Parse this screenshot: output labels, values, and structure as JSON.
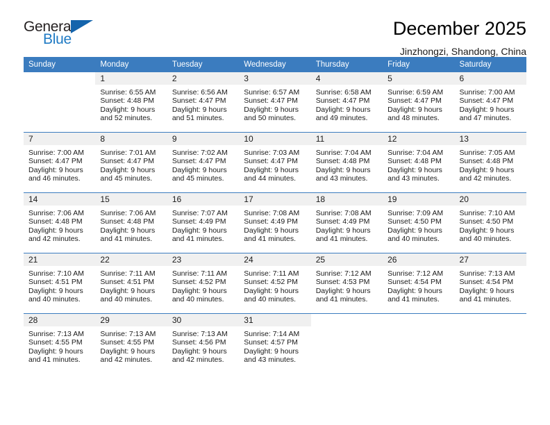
{
  "brand": {
    "name_top": "General",
    "name_bottom": "Blue",
    "triangle_color": "#1464ac",
    "blue_color": "#1f7ac4"
  },
  "header": {
    "title": "December 2025",
    "subtitle": "Jinzhongzi, Shandong, China",
    "header_bg": "#3b7cbf",
    "daynum_bg": "#f0f0f0"
  },
  "weekdays": [
    "Sunday",
    "Monday",
    "Tuesday",
    "Wednesday",
    "Thursday",
    "Friday",
    "Saturday"
  ],
  "weeks": [
    [
      {
        "day": "",
        "sunrise": "",
        "sunset": "",
        "daylight1": "",
        "daylight2": ""
      },
      {
        "day": "1",
        "sunrise": "Sunrise: 6:55 AM",
        "sunset": "Sunset: 4:48 PM",
        "daylight1": "Daylight: 9 hours",
        "daylight2": "and 52 minutes."
      },
      {
        "day": "2",
        "sunrise": "Sunrise: 6:56 AM",
        "sunset": "Sunset: 4:47 PM",
        "daylight1": "Daylight: 9 hours",
        "daylight2": "and 51 minutes."
      },
      {
        "day": "3",
        "sunrise": "Sunrise: 6:57 AM",
        "sunset": "Sunset: 4:47 PM",
        "daylight1": "Daylight: 9 hours",
        "daylight2": "and 50 minutes."
      },
      {
        "day": "4",
        "sunrise": "Sunrise: 6:58 AM",
        "sunset": "Sunset: 4:47 PM",
        "daylight1": "Daylight: 9 hours",
        "daylight2": "and 49 minutes."
      },
      {
        "day": "5",
        "sunrise": "Sunrise: 6:59 AM",
        "sunset": "Sunset: 4:47 PM",
        "daylight1": "Daylight: 9 hours",
        "daylight2": "and 48 minutes."
      },
      {
        "day": "6",
        "sunrise": "Sunrise: 7:00 AM",
        "sunset": "Sunset: 4:47 PM",
        "daylight1": "Daylight: 9 hours",
        "daylight2": "and 47 minutes."
      }
    ],
    [
      {
        "day": "7",
        "sunrise": "Sunrise: 7:00 AM",
        "sunset": "Sunset: 4:47 PM",
        "daylight1": "Daylight: 9 hours",
        "daylight2": "and 46 minutes."
      },
      {
        "day": "8",
        "sunrise": "Sunrise: 7:01 AM",
        "sunset": "Sunset: 4:47 PM",
        "daylight1": "Daylight: 9 hours",
        "daylight2": "and 45 minutes."
      },
      {
        "day": "9",
        "sunrise": "Sunrise: 7:02 AM",
        "sunset": "Sunset: 4:47 PM",
        "daylight1": "Daylight: 9 hours",
        "daylight2": "and 45 minutes."
      },
      {
        "day": "10",
        "sunrise": "Sunrise: 7:03 AM",
        "sunset": "Sunset: 4:47 PM",
        "daylight1": "Daylight: 9 hours",
        "daylight2": "and 44 minutes."
      },
      {
        "day": "11",
        "sunrise": "Sunrise: 7:04 AM",
        "sunset": "Sunset: 4:48 PM",
        "daylight1": "Daylight: 9 hours",
        "daylight2": "and 43 minutes."
      },
      {
        "day": "12",
        "sunrise": "Sunrise: 7:04 AM",
        "sunset": "Sunset: 4:48 PM",
        "daylight1": "Daylight: 9 hours",
        "daylight2": "and 43 minutes."
      },
      {
        "day": "13",
        "sunrise": "Sunrise: 7:05 AM",
        "sunset": "Sunset: 4:48 PM",
        "daylight1": "Daylight: 9 hours",
        "daylight2": "and 42 minutes."
      }
    ],
    [
      {
        "day": "14",
        "sunrise": "Sunrise: 7:06 AM",
        "sunset": "Sunset: 4:48 PM",
        "daylight1": "Daylight: 9 hours",
        "daylight2": "and 42 minutes."
      },
      {
        "day": "15",
        "sunrise": "Sunrise: 7:06 AM",
        "sunset": "Sunset: 4:48 PM",
        "daylight1": "Daylight: 9 hours",
        "daylight2": "and 41 minutes."
      },
      {
        "day": "16",
        "sunrise": "Sunrise: 7:07 AM",
        "sunset": "Sunset: 4:49 PM",
        "daylight1": "Daylight: 9 hours",
        "daylight2": "and 41 minutes."
      },
      {
        "day": "17",
        "sunrise": "Sunrise: 7:08 AM",
        "sunset": "Sunset: 4:49 PM",
        "daylight1": "Daylight: 9 hours",
        "daylight2": "and 41 minutes."
      },
      {
        "day": "18",
        "sunrise": "Sunrise: 7:08 AM",
        "sunset": "Sunset: 4:49 PM",
        "daylight1": "Daylight: 9 hours",
        "daylight2": "and 41 minutes."
      },
      {
        "day": "19",
        "sunrise": "Sunrise: 7:09 AM",
        "sunset": "Sunset: 4:50 PM",
        "daylight1": "Daylight: 9 hours",
        "daylight2": "and 40 minutes."
      },
      {
        "day": "20",
        "sunrise": "Sunrise: 7:10 AM",
        "sunset": "Sunset: 4:50 PM",
        "daylight1": "Daylight: 9 hours",
        "daylight2": "and 40 minutes."
      }
    ],
    [
      {
        "day": "21",
        "sunrise": "Sunrise: 7:10 AM",
        "sunset": "Sunset: 4:51 PM",
        "daylight1": "Daylight: 9 hours",
        "daylight2": "and 40 minutes."
      },
      {
        "day": "22",
        "sunrise": "Sunrise: 7:11 AM",
        "sunset": "Sunset: 4:51 PM",
        "daylight1": "Daylight: 9 hours",
        "daylight2": "and 40 minutes."
      },
      {
        "day": "23",
        "sunrise": "Sunrise: 7:11 AM",
        "sunset": "Sunset: 4:52 PM",
        "daylight1": "Daylight: 9 hours",
        "daylight2": "and 40 minutes."
      },
      {
        "day": "24",
        "sunrise": "Sunrise: 7:11 AM",
        "sunset": "Sunset: 4:52 PM",
        "daylight1": "Daylight: 9 hours",
        "daylight2": "and 40 minutes."
      },
      {
        "day": "25",
        "sunrise": "Sunrise: 7:12 AM",
        "sunset": "Sunset: 4:53 PM",
        "daylight1": "Daylight: 9 hours",
        "daylight2": "and 41 minutes."
      },
      {
        "day": "26",
        "sunrise": "Sunrise: 7:12 AM",
        "sunset": "Sunset: 4:54 PM",
        "daylight1": "Daylight: 9 hours",
        "daylight2": "and 41 minutes."
      },
      {
        "day": "27",
        "sunrise": "Sunrise: 7:13 AM",
        "sunset": "Sunset: 4:54 PM",
        "daylight1": "Daylight: 9 hours",
        "daylight2": "and 41 minutes."
      }
    ],
    [
      {
        "day": "28",
        "sunrise": "Sunrise: 7:13 AM",
        "sunset": "Sunset: 4:55 PM",
        "daylight1": "Daylight: 9 hours",
        "daylight2": "and 41 minutes."
      },
      {
        "day": "29",
        "sunrise": "Sunrise: 7:13 AM",
        "sunset": "Sunset: 4:55 PM",
        "daylight1": "Daylight: 9 hours",
        "daylight2": "and 42 minutes."
      },
      {
        "day": "30",
        "sunrise": "Sunrise: 7:13 AM",
        "sunset": "Sunset: 4:56 PM",
        "daylight1": "Daylight: 9 hours",
        "daylight2": "and 42 minutes."
      },
      {
        "day": "31",
        "sunrise": "Sunrise: 7:14 AM",
        "sunset": "Sunset: 4:57 PM",
        "daylight1": "Daylight: 9 hours",
        "daylight2": "and 43 minutes."
      },
      {
        "day": "",
        "sunrise": "",
        "sunset": "",
        "daylight1": "",
        "daylight2": ""
      },
      {
        "day": "",
        "sunrise": "",
        "sunset": "",
        "daylight1": "",
        "daylight2": ""
      },
      {
        "day": "",
        "sunrise": "",
        "sunset": "",
        "daylight1": "",
        "daylight2": ""
      }
    ]
  ]
}
